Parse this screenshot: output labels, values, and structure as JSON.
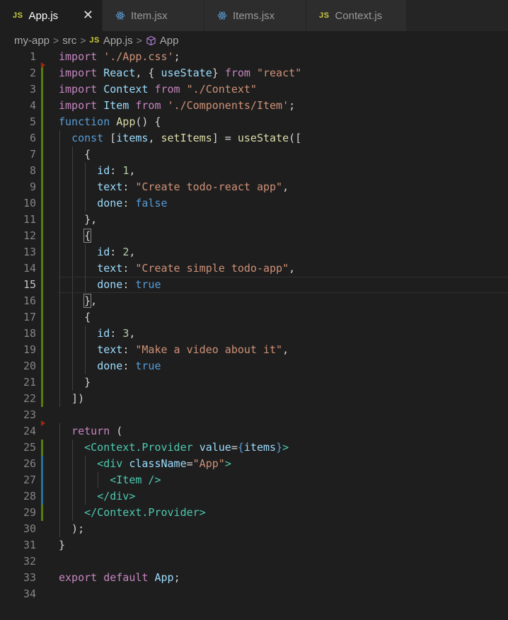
{
  "tabs": [
    {
      "label": "App.js",
      "icon": "js-icon",
      "icon_text": "JS",
      "active": true,
      "close": "✕"
    },
    {
      "label": "Item.jsx",
      "icon": "react-icon",
      "active": false
    },
    {
      "label": "Items.jsx",
      "icon": "react-icon",
      "active": false
    },
    {
      "label": "Context.js",
      "icon": "js-icon",
      "icon_text": "JS",
      "active": false
    }
  ],
  "breadcrumb": {
    "items": [
      "my-app",
      "src",
      "App.js",
      "App"
    ],
    "js_icon_text": "JS",
    "separator": ">"
  },
  "colors": {
    "keyword": "#c586c0",
    "string": "#ce9178",
    "variable": "#9cdcfe",
    "function": "#dcdcaa",
    "number": "#b5cea8",
    "boolean": "#569cd6",
    "tag": "#4ec9b0",
    "modified_gutter": "#587c0c",
    "added_gutter": "#2a6f97"
  },
  "editor": {
    "current_line": 15,
    "lines": [
      [
        [
          "kw",
          "import"
        ],
        [
          "pu",
          " "
        ],
        [
          "st",
          "'./App.css'"
        ],
        [
          "pu",
          ";"
        ]
      ],
      [
        [
          "kw",
          "import"
        ],
        [
          "pu",
          " "
        ],
        [
          "vr",
          "React"
        ],
        [
          "pu",
          ", { "
        ],
        [
          "vr",
          "useState"
        ],
        [
          "pu",
          "} "
        ],
        [
          "kw",
          "from"
        ],
        [
          "pu",
          " "
        ],
        [
          "st",
          "\"react\""
        ]
      ],
      [
        [
          "kw",
          "import"
        ],
        [
          "pu",
          " "
        ],
        [
          "vr",
          "Context"
        ],
        [
          "pu",
          " "
        ],
        [
          "kw",
          "from"
        ],
        [
          "pu",
          " "
        ],
        [
          "st",
          "\"./Context\""
        ]
      ],
      [
        [
          "kw",
          "import"
        ],
        [
          "pu",
          " "
        ],
        [
          "vr",
          "Item"
        ],
        [
          "pu",
          " "
        ],
        [
          "kw",
          "from"
        ],
        [
          "pu",
          " "
        ],
        [
          "st",
          "'./Components/Item'"
        ],
        [
          "pu",
          ";"
        ]
      ],
      [
        [
          "bk",
          "function"
        ],
        [
          "pu",
          " "
        ],
        [
          "fn",
          "App"
        ],
        [
          "pu",
          "() {"
        ]
      ],
      [
        [
          "pu",
          "  "
        ],
        [
          "bk",
          "const"
        ],
        [
          "pu",
          " ["
        ],
        [
          "vr",
          "items"
        ],
        [
          "pu",
          ", "
        ],
        [
          "fn",
          "setItems"
        ],
        [
          "pu",
          "] = "
        ],
        [
          "fn",
          "useState"
        ],
        [
          "pu",
          "(["
        ]
      ],
      [
        [
          "pu",
          "    {"
        ]
      ],
      [
        [
          "pu",
          "      "
        ],
        [
          "vr",
          "id"
        ],
        [
          "pu",
          ": "
        ],
        [
          "nm",
          "1"
        ],
        [
          "pu",
          ","
        ]
      ],
      [
        [
          "pu",
          "      "
        ],
        [
          "vr",
          "text"
        ],
        [
          "pu",
          ": "
        ],
        [
          "st",
          "\"Create todo-react app\""
        ],
        [
          "pu",
          ","
        ]
      ],
      [
        [
          "pu",
          "      "
        ],
        [
          "vr",
          "done"
        ],
        [
          "pu",
          ": "
        ],
        [
          "bk",
          "false"
        ]
      ],
      [
        [
          "pu",
          "    },"
        ]
      ],
      [
        [
          "pu",
          "    "
        ],
        [
          "br",
          "{"
        ]
      ],
      [
        [
          "pu",
          "      "
        ],
        [
          "vr",
          "id"
        ],
        [
          "pu",
          ": "
        ],
        [
          "nm",
          "2"
        ],
        [
          "pu",
          ","
        ]
      ],
      [
        [
          "pu",
          "      "
        ],
        [
          "vr",
          "text"
        ],
        [
          "pu",
          ": "
        ],
        [
          "st",
          "\"Create simple todo-app\""
        ],
        [
          "pu",
          ","
        ]
      ],
      [
        [
          "pu",
          "      "
        ],
        [
          "vr",
          "done"
        ],
        [
          "pu",
          ": "
        ],
        [
          "bk",
          "true"
        ]
      ],
      [
        [
          "pu",
          "    "
        ],
        [
          "br",
          "}"
        ],
        [
          "pu",
          ","
        ]
      ],
      [
        [
          "pu",
          "    {"
        ]
      ],
      [
        [
          "pu",
          "      "
        ],
        [
          "vr",
          "id"
        ],
        [
          "pu",
          ": "
        ],
        [
          "nm",
          "3"
        ],
        [
          "pu",
          ","
        ]
      ],
      [
        [
          "pu",
          "      "
        ],
        [
          "vr",
          "text"
        ],
        [
          "pu",
          ": "
        ],
        [
          "st",
          "\"Make a video about it\""
        ],
        [
          "pu",
          ","
        ]
      ],
      [
        [
          "pu",
          "      "
        ],
        [
          "vr",
          "done"
        ],
        [
          "pu",
          ": "
        ],
        [
          "bk",
          "true"
        ]
      ],
      [
        [
          "pu",
          "    }"
        ]
      ],
      [
        [
          "pu",
          "  ])"
        ]
      ],
      [],
      [
        [
          "pu",
          "  "
        ],
        [
          "kw",
          "return"
        ],
        [
          "pu",
          " ("
        ]
      ],
      [
        [
          "pu",
          "    "
        ],
        [
          "tg",
          "<Context.Provider"
        ],
        [
          "pu",
          " "
        ],
        [
          "vr",
          "value"
        ],
        [
          "pu",
          "="
        ],
        [
          "bk",
          "{"
        ],
        [
          "vr",
          "items"
        ],
        [
          "bk",
          "}"
        ],
        [
          "tg",
          ">"
        ]
      ],
      [
        [
          "pu",
          "      "
        ],
        [
          "tg",
          "<div"
        ],
        [
          "pu",
          " "
        ],
        [
          "vr",
          "className"
        ],
        [
          "pu",
          "="
        ],
        [
          "st",
          "\"App\""
        ],
        [
          "tg",
          ">"
        ]
      ],
      [
        [
          "pu",
          "        "
        ],
        [
          "tg",
          "<Item />"
        ]
      ],
      [
        [
          "pu",
          "      "
        ],
        [
          "tg",
          "</div>"
        ]
      ],
      [
        [
          "pu",
          "    "
        ],
        [
          "tg",
          "</Context.Provider>"
        ]
      ],
      [
        [
          "pu",
          "  );"
        ]
      ],
      [
        [
          "pu",
          "}"
        ]
      ],
      [],
      [
        [
          "kw",
          "export"
        ],
        [
          "pu",
          " "
        ],
        [
          "kw",
          "default"
        ],
        [
          "pu",
          " "
        ],
        [
          "vr",
          "App"
        ],
        [
          "pu",
          ";"
        ]
      ],
      []
    ]
  }
}
